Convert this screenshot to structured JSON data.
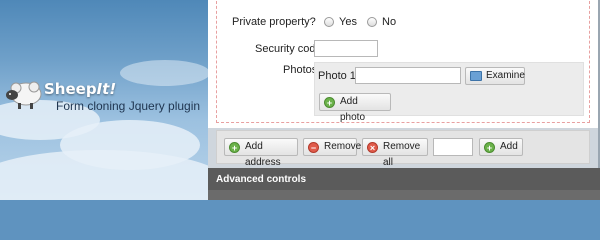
{
  "banner": {
    "logo_main": "Sheep",
    "logo_accent": "It!",
    "subtitle": "Form cloning Jquery plugin"
  },
  "form": {
    "private_label": "Private property?",
    "yes_label": "Yes",
    "no_label": "No",
    "security_label": "Security code",
    "security_value": "",
    "photos_label": "Photos",
    "photo_item_label": "Photo 1",
    "photo_value": "",
    "examine_label": "Examine",
    "add_photo_label": "Add photo"
  },
  "controls": {
    "add_address_label": "Add address",
    "remove_label": "Remove",
    "remove_all_label": "Remove all",
    "count_value": "",
    "add_label": "Add",
    "footer_title": "Advanced controls"
  },
  "colors": {
    "add_icon": "#6bb24a",
    "remove_icon": "#e05b4b",
    "footer_bg": "#5b5b5b"
  },
  "icons": [
    "sheep-icon",
    "add-icon",
    "remove-icon",
    "folder-icon"
  ]
}
